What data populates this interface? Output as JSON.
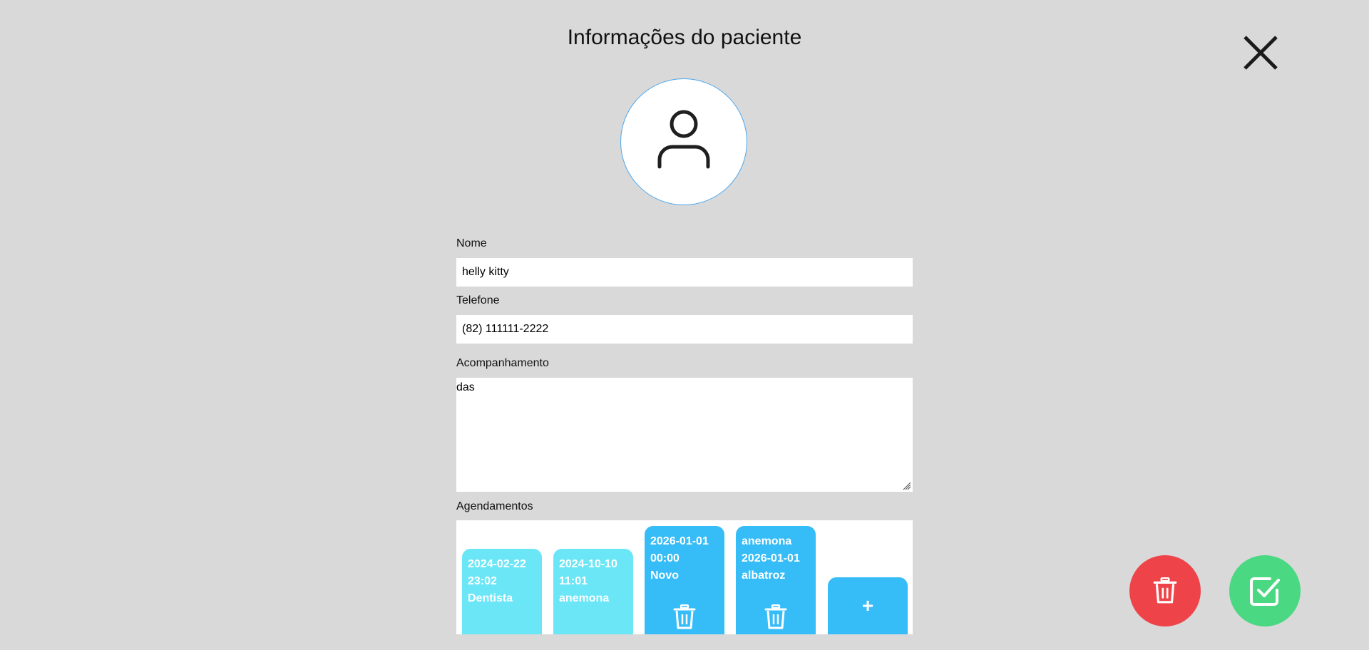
{
  "modal": {
    "title": "Informações do paciente"
  },
  "form": {
    "name_label": "Nome",
    "name_value": "helly kitty",
    "phone_label": "Telefone",
    "phone_value": "(82) 111111-2222",
    "notes_label": "Acompanhamento",
    "notes_value": "das",
    "appointments_label": "Agendamentos"
  },
  "appointments": [
    {
      "line1": "2024-02-22",
      "line2": "23:02",
      "line3": "Dentista",
      "status": "past"
    },
    {
      "line1": "2024-10-10",
      "line2": "11:01",
      "line3": "anemona",
      "status": "past"
    },
    {
      "line1": "2026-01-01",
      "line2": "00:00",
      "line3": "Novo",
      "status": "future"
    },
    {
      "line1": "anemona",
      "line2": "2026-01-01",
      "line3": "albatroz",
      "status": "future"
    }
  ],
  "add_appointment_label": "+",
  "icons": {
    "close": "close-icon",
    "avatar": "user-icon",
    "trash": "trash-icon",
    "save": "check-square-icon"
  },
  "colors": {
    "background": "#d9d9d9",
    "past_card": "#6be6f7",
    "future_card": "#36bcf7",
    "delete_button": "#ee4449",
    "save_button": "#4ad882",
    "avatar_border": "#4aa8f0"
  }
}
